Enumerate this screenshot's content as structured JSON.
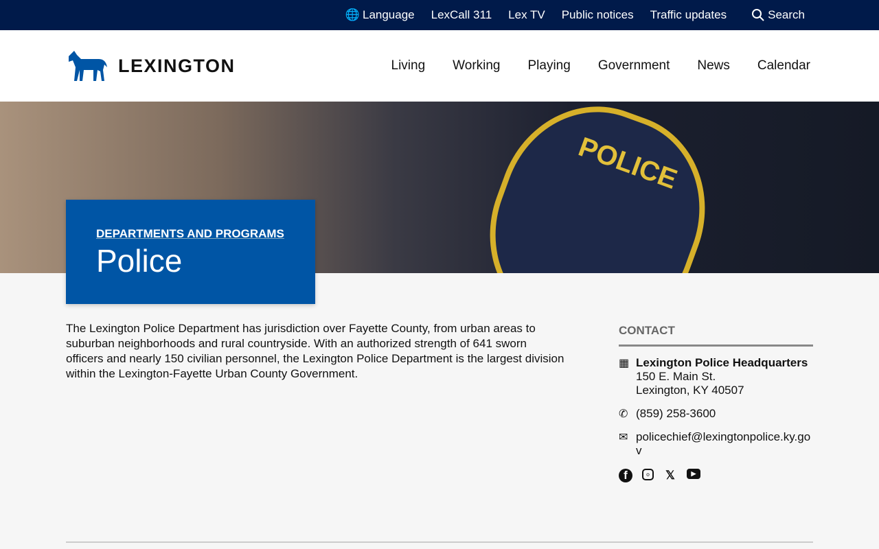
{
  "utility_nav": {
    "language": "Language",
    "lexcall": "LexCall 311",
    "lextv": "Lex TV",
    "notices": "Public notices",
    "traffic": "Traffic updates",
    "search": "Search"
  },
  "logo": {
    "text": "LEXINGTON"
  },
  "nav": [
    "Living",
    "Working",
    "Playing",
    "Government",
    "News",
    "Calendar"
  ],
  "hero": {
    "patch_text": "POLICE",
    "breadcrumb": "DEPARTMENTS AND PROGRAMS",
    "title": "Police"
  },
  "description": "The Lexington Police Department has jurisdiction over Fayette County, from urban areas to suburban neighborhoods and rural countryside. With an authorized strength of 641 sworn officers and nearly 150 civilian personnel, the Lexington Police Department is the largest division within the Lexington-Fayette Urban County Government.",
  "contact": {
    "heading": "CONTACT",
    "name": "Lexington Police Headquarters",
    "address1": "150 E. Main St.",
    "address2": "Lexington, KY 40507",
    "phone": "(859) 258-3600",
    "email": "policechief@lexingtonpolice.ky.gov"
  },
  "social": [
    "facebook-icon",
    "instagram-icon",
    "x-icon",
    "youtube-icon"
  ],
  "colors": {
    "utility_bar": "#001a4a",
    "accent": "#0055a5"
  }
}
